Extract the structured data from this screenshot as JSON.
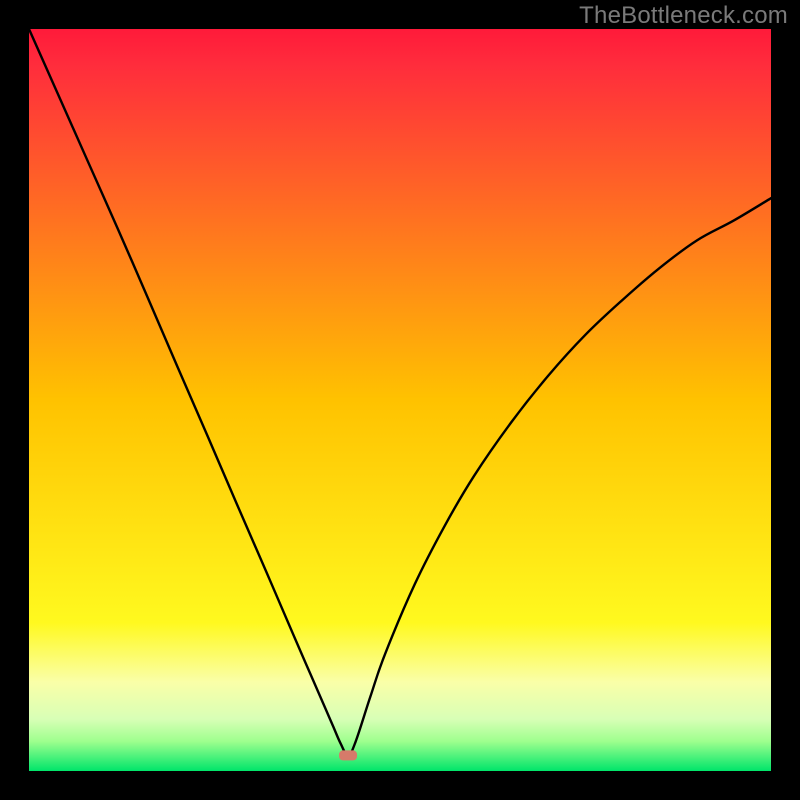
{
  "watermark": "TheBottleneck.com",
  "chart_data": {
    "type": "line",
    "title": "",
    "xlabel": "",
    "ylabel": "",
    "xlim": [
      0,
      100
    ],
    "ylim": [
      0,
      100
    ],
    "legend": false,
    "background_gradient": {
      "stops": [
        {
          "pos": 0.0,
          "color": "#ff1a3a"
        },
        {
          "pos": 0.05,
          "color": "#ff2d3c"
        },
        {
          "pos": 0.5,
          "color": "#ffc200"
        },
        {
          "pos": 0.8,
          "color": "#fff91f"
        },
        {
          "pos": 0.88,
          "color": "#faffa8"
        },
        {
          "pos": 0.93,
          "color": "#d8ffb6"
        },
        {
          "pos": 0.96,
          "color": "#9eff8e"
        },
        {
          "pos": 1.0,
          "color": "#00e56a"
        }
      ]
    },
    "minimum_marker": {
      "x": 43,
      "y": 2.1,
      "color": "#d67b6a"
    },
    "series": [
      {
        "name": "bottleneck-curve",
        "x": [
          0,
          4,
          8,
          12,
          16,
          20,
          24,
          28,
          32,
          36,
          38,
          40,
          41,
          42,
          43,
          44,
          46,
          48,
          52,
          56,
          60,
          65,
          70,
          75,
          80,
          85,
          90,
          95,
          100
        ],
        "values": [
          100,
          91,
          82,
          73,
          63.8,
          54.5,
          45.3,
          36,
          26.8,
          17.5,
          12.9,
          8.3,
          6,
          3.7,
          2.1,
          3.9,
          10,
          15.8,
          25.2,
          33,
          39.8,
          47,
          53.3,
          58.8,
          63.5,
          67.8,
          71.5,
          74.2,
          77.2
        ]
      }
    ]
  }
}
